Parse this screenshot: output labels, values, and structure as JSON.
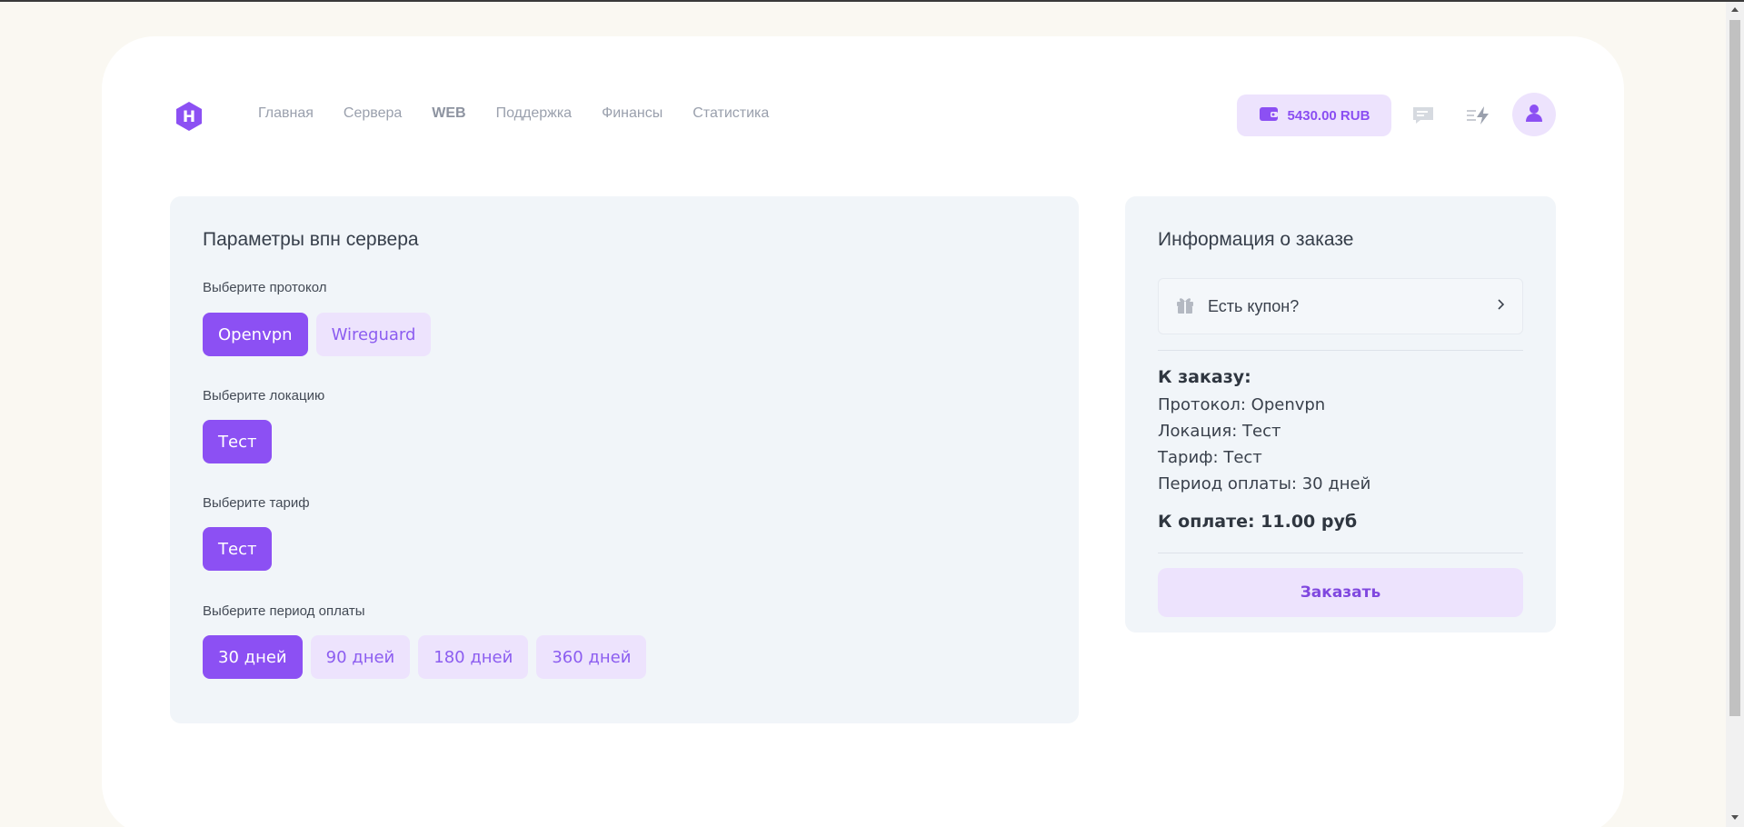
{
  "nav": {
    "items": [
      {
        "label": "Главная",
        "bold": false
      },
      {
        "label": "Сервера",
        "bold": false
      },
      {
        "label": "WEB",
        "bold": true
      },
      {
        "label": "Поддержка",
        "bold": false
      },
      {
        "label": "Финансы",
        "bold": false
      },
      {
        "label": "Статистика",
        "bold": false
      }
    ]
  },
  "header": {
    "balance": "5430.00 RUB",
    "icons": [
      "wallet-icon",
      "chat-icon",
      "flash-icon",
      "user-icon"
    ]
  },
  "params": {
    "title": "Параметры впн сервера",
    "protocol_label": "Выберите протокол",
    "protocols": [
      {
        "label": "Openvpn",
        "active": true
      },
      {
        "label": "Wireguard",
        "active": false
      }
    ],
    "location_label": "Выберите локацию",
    "locations": [
      {
        "label": "Тест",
        "active": true
      }
    ],
    "tariff_label": "Выберите тариф",
    "tariffs": [
      {
        "label": "Тест",
        "active": true
      }
    ],
    "period_label": "Выберите период оплаты",
    "periods": [
      {
        "label": "30 дней",
        "active": true
      },
      {
        "label": "90 дней",
        "active": false
      },
      {
        "label": "180 дней",
        "active": false
      },
      {
        "label": "360 дней",
        "active": false
      }
    ]
  },
  "order": {
    "title": "Информация о заказе",
    "coupon_text": "Есть купон?",
    "summary_title": "К заказу:",
    "lines": [
      "Протокол: Openvpn",
      "Локация: Тест",
      "Тариф: Тест",
      "Период оплаты: 30 дней"
    ],
    "total": "К оплате: 11.00 руб",
    "order_button": "Заказать"
  },
  "colors": {
    "accent": "#8c50f3",
    "accent_light": "#ede3fd",
    "page_bg": "#faf8f2",
    "card_bg": "#f1f5f9"
  }
}
